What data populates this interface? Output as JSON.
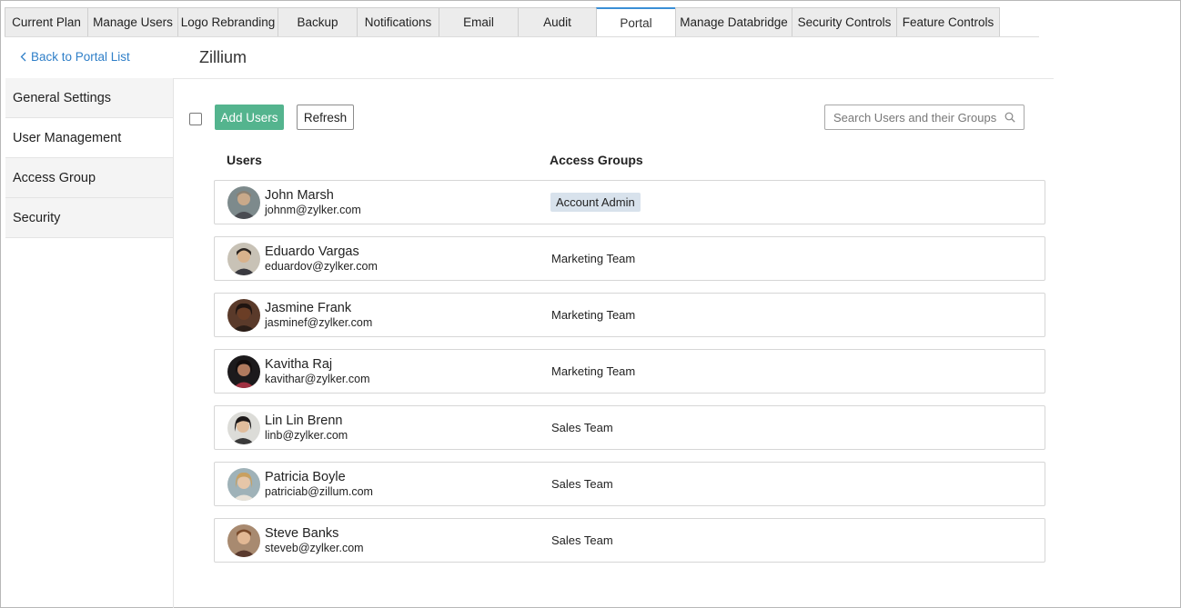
{
  "tabs": [
    {
      "label": "Current Plan",
      "active": false
    },
    {
      "label": "Manage Users",
      "active": false
    },
    {
      "label": "Logo Rebranding",
      "active": false
    },
    {
      "label": "Backup",
      "active": false
    },
    {
      "label": "Notifications",
      "active": false
    },
    {
      "label": "Email",
      "active": false
    },
    {
      "label": "Audit",
      "active": false
    },
    {
      "label": "Portal",
      "active": true
    },
    {
      "label": "Manage Databridge",
      "active": false
    },
    {
      "label": "Security Controls",
      "active": false
    },
    {
      "label": "Feature Controls",
      "active": false
    }
  ],
  "back_link": "Back to Portal List",
  "portal_name": "Zillium",
  "sidebar": {
    "items": [
      {
        "label": "General Settings",
        "active": false
      },
      {
        "label": "User Management",
        "active": true
      },
      {
        "label": "Access Group",
        "active": false
      },
      {
        "label": "Security",
        "active": false
      }
    ]
  },
  "toolbar": {
    "add_label": "Add Users",
    "refresh_label": "Refresh",
    "search_placeholder": "Search Users and their Groups"
  },
  "table": {
    "headers": {
      "users": "Users",
      "groups": "Access Groups"
    },
    "rows": [
      {
        "name": "John Marsh",
        "email": "johnm@zylker.com",
        "group": "Account Admin",
        "badge": true
      },
      {
        "name": "Eduardo Vargas",
        "email": "eduardov@zylker.com",
        "group": "Marketing Team",
        "badge": false
      },
      {
        "name": "Jasmine Frank",
        "email": "jasminef@zylker.com",
        "group": "Marketing Team",
        "badge": false
      },
      {
        "name": "Kavitha Raj",
        "email": "kavithar@zylker.com",
        "group": "Marketing Team",
        "badge": false
      },
      {
        "name": "Lin Lin Brenn",
        "email": "linb@zylker.com",
        "group": "Sales Team",
        "badge": false
      },
      {
        "name": "Patricia Boyle",
        "email": "patriciab@zillum.com",
        "group": "Sales Team",
        "badge": false
      },
      {
        "name": "Steve Banks",
        "email": "steveb@zylker.com",
        "group": "Sales Team",
        "badge": false
      }
    ]
  },
  "colors": {
    "accent": "#3a8fd6",
    "link": "#2f7fc8",
    "add_button": "#54b48e",
    "badge_bg": "#d8e2ec"
  },
  "icons": {
    "back": "chevron-left-icon",
    "search": "search-icon",
    "avatar": "avatar-photo"
  }
}
